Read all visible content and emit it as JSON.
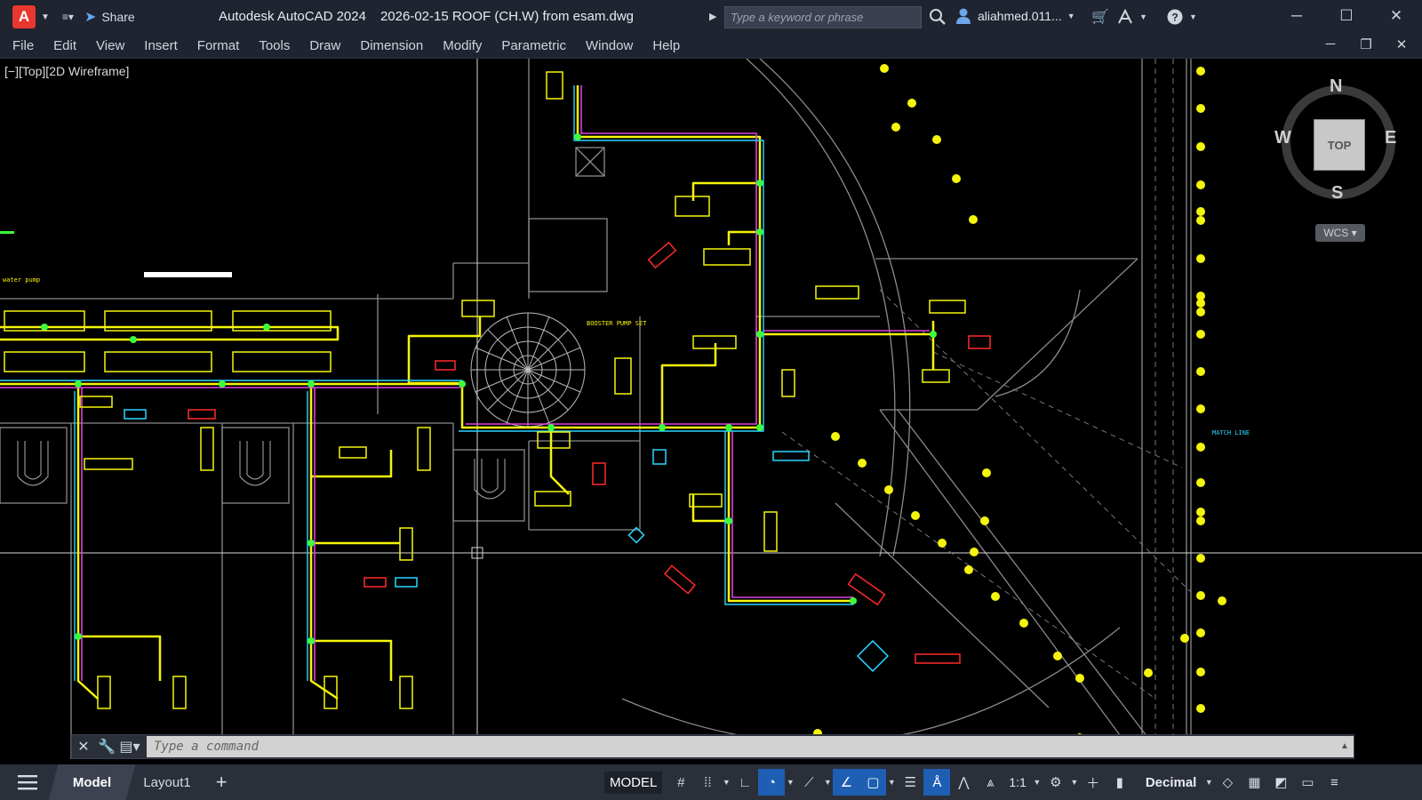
{
  "titlebar": {
    "app_logo": "A",
    "share_label": "Share",
    "app_name": "Autodesk AutoCAD 2024",
    "document": "2026-02-15 ROOF (CH.W) from esam.dwg",
    "search_placeholder": "Type a keyword or phrase",
    "username": "aliahmed.011...",
    "icons": [
      "cart-icon",
      "autodesk-a360-icon",
      "help-icon",
      "minimize-icon",
      "maximize-icon",
      "close-icon"
    ]
  },
  "menu": [
    "File",
    "Edit",
    "View",
    "Insert",
    "Format",
    "Tools",
    "Draw",
    "Dimension",
    "Modify",
    "Parametric",
    "Window",
    "Help"
  ],
  "viewport": {
    "label": "[−][Top][2D Wireframe]"
  },
  "viewcube": {
    "face": "TOP",
    "north": "N",
    "south": "S",
    "east": "E",
    "west": "W",
    "ucs": "WCS"
  },
  "command": {
    "placeholder": "Type a command"
  },
  "statusbar": {
    "tab_model": "Model",
    "tab_layout": "Layout1",
    "space": "MODEL",
    "scale": "1:1",
    "units": "Decimal"
  },
  "colors": {
    "background": "#000000",
    "titlebar": "#1f2430",
    "pipe_yellow": "#f5f50a",
    "pipe_green": "#3cff3c",
    "pipe_magenta": "#e040e0",
    "pipe_cyan": "#2ad7ff",
    "equipment_red": "#ff2a2a",
    "wall_grey": "#8a8a8a",
    "accent_blue": "#1e5fb3"
  }
}
